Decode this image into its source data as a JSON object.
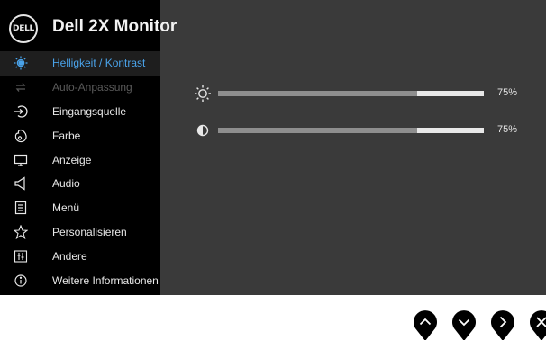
{
  "header": {
    "logo_text": "DELL",
    "title": "Dell 2X Monitor"
  },
  "menu": [
    {
      "label": "Helligkeit / Kontrast",
      "icon": "brightness-icon",
      "state": "active"
    },
    {
      "label": "Auto-Anpassung",
      "icon": "auto-adjust-icon",
      "state": "disabled"
    },
    {
      "label": "Eingangsquelle",
      "icon": "input-source-icon",
      "state": "normal"
    },
    {
      "label": "Farbe",
      "icon": "color-icon",
      "state": "normal"
    },
    {
      "label": "Anzeige",
      "icon": "display-icon",
      "state": "normal"
    },
    {
      "label": "Audio",
      "icon": "speaker-icon",
      "state": "normal"
    },
    {
      "label": "Menü",
      "icon": "menu-list-icon",
      "state": "normal"
    },
    {
      "label": "Personalisieren",
      "icon": "star-icon",
      "state": "normal"
    },
    {
      "label": "Andere",
      "icon": "other-settings-icon",
      "state": "normal"
    },
    {
      "label": "Weitere Informationen",
      "icon": "info-icon",
      "state": "normal"
    }
  ],
  "controls": {
    "brightness": {
      "icon": "sun-icon",
      "value_text": "75%",
      "level": 0.75
    },
    "contrast": {
      "icon": "contrast-icon",
      "value_text": "75%",
      "level": 0.75
    }
  },
  "nav_buttons": [
    {
      "name": "up-button",
      "icon": "chevron-up-icon"
    },
    {
      "name": "down-button",
      "icon": "chevron-down-icon"
    },
    {
      "name": "right-button",
      "icon": "chevron-right-icon"
    },
    {
      "name": "close-button",
      "icon": "close-icon"
    }
  ],
  "colors": {
    "osd_background": "#3a3a3a",
    "sidebar_background": "#000000",
    "active_text": "#4aa3ea",
    "slider_fill": "#8e8e8e",
    "slider_track": "#e8e8e8"
  }
}
